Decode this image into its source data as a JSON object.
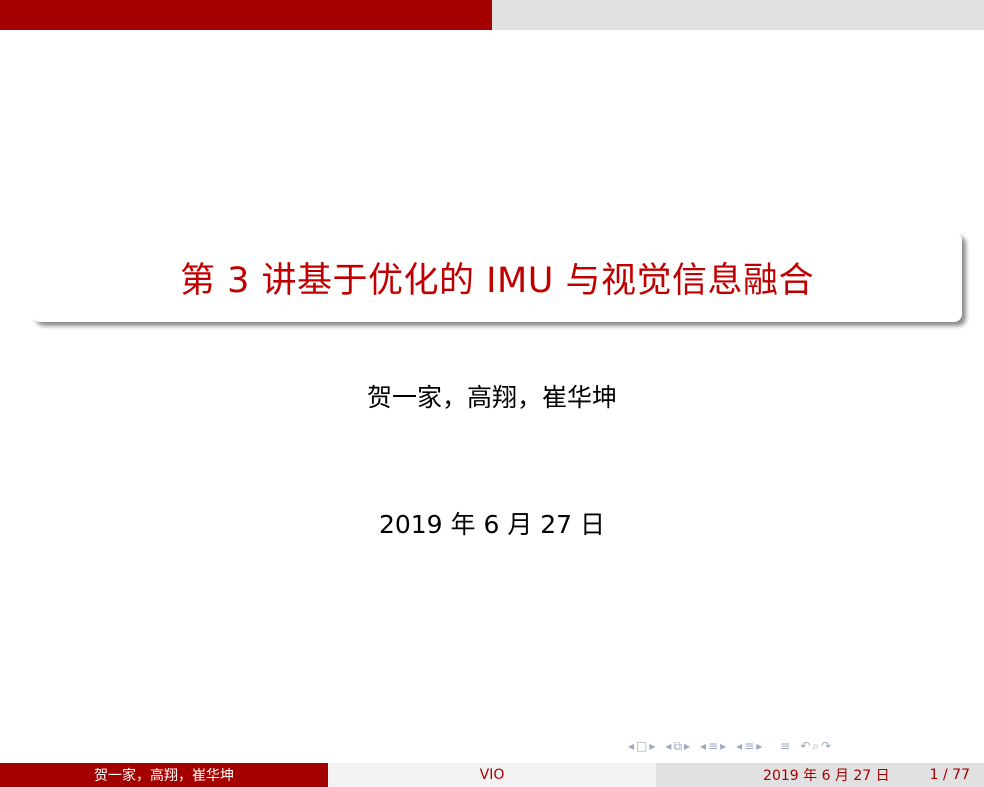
{
  "header": {
    "progress_fraction": 0.5
  },
  "slide": {
    "title": "第 3 讲基于优化的 IMU 与视觉信息融合",
    "authors": "贺一家，高翔，崔华坤",
    "date": "2019 年 6 月 27 日"
  },
  "navigation": {
    "icons": [
      "frame-prev",
      "frame-icon",
      "frame-next",
      "subsection-prev",
      "subsection-icon",
      "subsection-next",
      "section-prev",
      "section-icon",
      "section-next",
      "toc-prev",
      "toc-icon",
      "toc-next",
      "align-icon",
      "search-icon",
      "back-icon"
    ]
  },
  "footer": {
    "authors": "贺一家，高翔，崔华坤",
    "short_title": "VIO",
    "date": "2019 年 6 月 27 日",
    "page": "1 / 77"
  },
  "colors": {
    "accent": "#a40000",
    "title_red": "#c00000",
    "bar_gray": "#e1e1e1",
    "nav_icon": "#9aa8c4"
  }
}
